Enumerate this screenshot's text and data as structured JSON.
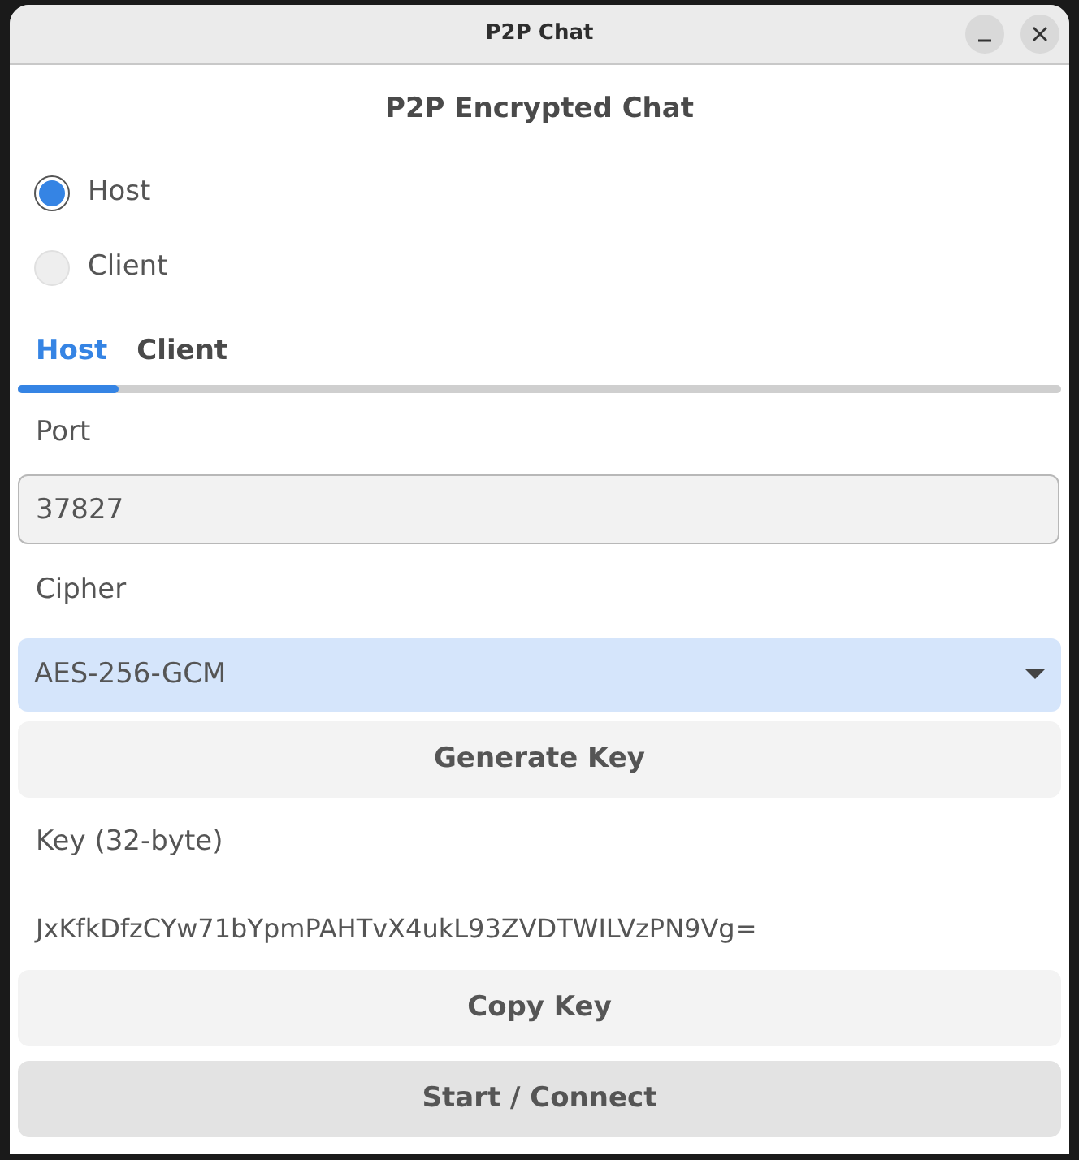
{
  "window": {
    "title": "P2P Chat"
  },
  "heading": "P2P Encrypted Chat",
  "mode_options": [
    {
      "label": "Host",
      "selected": true
    },
    {
      "label": "Client",
      "selected": false
    }
  ],
  "tabs": [
    {
      "label": "Host",
      "selected": true
    },
    {
      "label": "Client",
      "selected": false
    }
  ],
  "port": {
    "label": "Port",
    "value": "37827"
  },
  "cipher": {
    "label": "Cipher",
    "value": "AES-256-GCM"
  },
  "generate_button": "Generate Key",
  "key": {
    "label": "Key (32-byte)",
    "value": "JxKfkDfzCYw71bYpmPAHTvX4ukL93ZVDTWILVzPN9Vg="
  },
  "copy_button": "Copy Key",
  "connect_button": "Start / Connect"
}
